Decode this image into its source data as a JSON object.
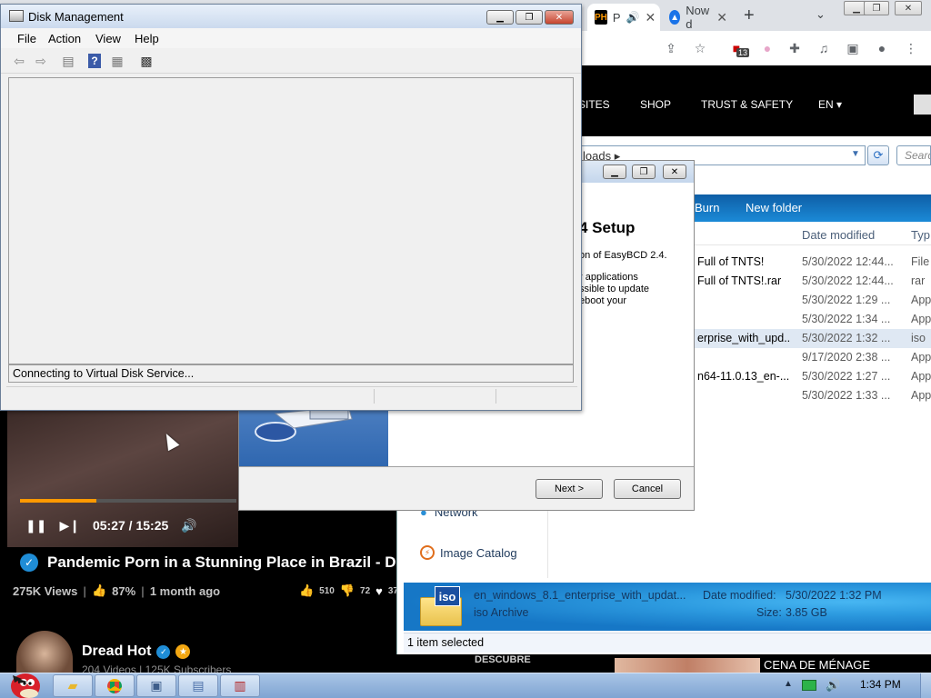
{
  "browser": {
    "tabs": [
      {
        "favicon": "PH",
        "label": "P"
      },
      {
        "favicon": "N",
        "label": "Now d"
      }
    ],
    "omnibox_icons": [
      "share-icon",
      "star-icon",
      "extension-badge-icon",
      "pride-icon",
      "puzzle-icon",
      "media-icon",
      "sidepanel-icon",
      "profile-icon",
      "kebab-icon"
    ],
    "extension_badge": "13"
  },
  "site": {
    "nav": [
      "SITES",
      "SHOP",
      "TRUST & SAFETY",
      "EN"
    ],
    "video": {
      "time_current": "05:27",
      "time_sep": " / ",
      "time_total": "15:25",
      "progress_fraction": 0.352,
      "title": "Pandemic Porn in a Stunning Place in Brazil - D",
      "views": "275K Views",
      "rating": "87%",
      "age": "1 month ago",
      "likes": "510",
      "dislikes": "72",
      "favorites": "37"
    },
    "channel": {
      "name": "Dread Hot",
      "meta": "204 Videos | 125K Subscribers"
    },
    "promo_left": "DESCUBRE",
    "promo_right": "CENA DE MÉNAGE"
  },
  "explorer": {
    "address": "loads",
    "search_placeholder": "Search",
    "toolbar": [
      "Burn",
      "New folder"
    ],
    "columns": [
      "Date modified",
      "Typ"
    ],
    "files": [
      {
        "name": "Full of TNTS!",
        "date": "5/30/2022 12:44...",
        "type": "File"
      },
      {
        "name": "Full of TNTS!.rar",
        "date": "5/30/2022 12:44...",
        "type": "rar"
      },
      {
        "name": "",
        "date": "5/30/2022 1:29 ...",
        "type": "App"
      },
      {
        "name": "",
        "date": "5/30/2022 1:34 ...",
        "type": "App"
      },
      {
        "name": "erprise_with_upd...",
        "date": "5/30/2022 1:32 ...",
        "type": "iso"
      },
      {
        "name": "",
        "date": "9/17/2020 2:38 ...",
        "type": "App"
      },
      {
        "name": "n64-11.0.13_en-...",
        "date": "5/30/2022 1:27 ...",
        "type": "App"
      },
      {
        "name": "",
        "date": "5/30/2022 1:33 ...",
        "type": "App"
      }
    ],
    "nav": {
      "network": "Network",
      "catalog": "Image Catalog"
    },
    "details": {
      "icon_label": "iso",
      "name": "en_windows_8.1_enterprise_with_updat...",
      "type": "iso Archive",
      "modified_label": "Date modified:",
      "modified_value": "5/30/2022 1:32 PM",
      "size_label": "Size:",
      "size_value": "3.85 GB"
    },
    "status": "1 item selected"
  },
  "setup": {
    "heading": "4 Setup",
    "line1": "on of EasyBCD 2.4.",
    "line2": "r applications",
    "line3": "ssible to update",
    "line4": "eboot your",
    "next": "Next >",
    "cancel": "Cancel"
  },
  "diskmgmt": {
    "title": "Disk Management",
    "menu": [
      "File",
      "Action",
      "View",
      "Help"
    ],
    "status": "Connecting to Virtual Disk Service..."
  },
  "taskbar": {
    "clock": "1:34 PM"
  }
}
